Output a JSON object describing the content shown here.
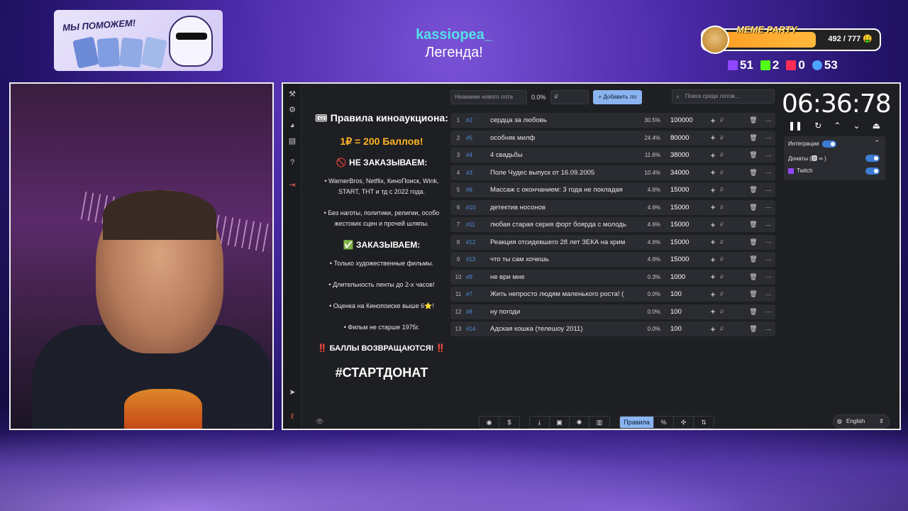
{
  "overlay": {
    "banner_text": "МЫ ПОМОЖЕМ!",
    "chat": {
      "username": "kassiopea_",
      "message": "Легенда!"
    },
    "meme_party": {
      "title": "MEME PARTY",
      "count": "492 / 777 🤑",
      "progress": 0.633
    },
    "stats": [
      {
        "icon": "twitch-icon",
        "value": "51",
        "color": "#9146ff"
      },
      {
        "icon": "kick-icon",
        "value": "2",
        "color": "#53fc18"
      },
      {
        "icon": "vklive-icon",
        "value": "0",
        "color": "#ff2d55"
      },
      {
        "icon": "viewer-icon",
        "value": "53",
        "color": "#4da3ff"
      }
    ]
  },
  "app": {
    "rules": {
      "title": "🎟 Правила киноаукциона:",
      "rate": "1₽ = 200 Баллов!",
      "no_heading": "🚫 НЕ ЗАКАЗЫВАЕМ:",
      "no_items": [
        "• WarnerBros, Netflix, КиноПоиск, Wink, START, ТНТ и тд с 2022 года.",
        "• Без наготы, политики, религии, особо жестоких сцен и прочей шляпы."
      ],
      "yes_heading": "✅ ЗАКАЗЫВАЕМ:",
      "yes_items": [
        "• Только художественные фильмы.",
        "• Длительность ленты до 2-х часов!",
        "• Оценка на Кинопоиске выше 6⭐!",
        "• Фильм не старше 1975г."
      ],
      "returns": "‼️ БАЛЛЫ ВОЗВРАЩАЮТСЯ! ‼️",
      "hashtag": "#СТАРТДОНАТ"
    },
    "toolbar": {
      "new_lot_placeholder": "Название нового лота",
      "percent": "0.0%",
      "amount_placeholder": "₽",
      "add_label": "+  Добавить ло",
      "search_placeholder": "Поиск среди лотов..."
    },
    "lots": [
      {
        "idx": "1",
        "id": "#2",
        "name": "сердца за любовь",
        "pct": "30.5%",
        "amount": "100000"
      },
      {
        "idx": "2",
        "id": "#5",
        "name": "особняк милф",
        "pct": "24.4%",
        "amount": "80000"
      },
      {
        "idx": "3",
        "id": "#4",
        "name": "4 свадьбы",
        "pct": "11.6%",
        "amount": "38000"
      },
      {
        "idx": "4",
        "id": "#3",
        "name": "Поле Чудес выпуск от 16.09.2005",
        "pct": "10.4%",
        "amount": "34000"
      },
      {
        "idx": "5",
        "id": "#6",
        "name": "Массаж с окончанием: 3 года не покладая",
        "pct": "4.6%",
        "amount": "15000"
      },
      {
        "idx": "6",
        "id": "#10",
        "name": "детектив носонов",
        "pct": "4.6%",
        "amount": "15000"
      },
      {
        "idx": "7",
        "id": "#11",
        "name": "любая старая серия форт боярда с молодь",
        "pct": "4.6%",
        "amount": "15000"
      },
      {
        "idx": "8",
        "id": "#12",
        "name": "Реакция отсидевшего 28 лет ЗЕКА на крим",
        "pct": "4.6%",
        "amount": "15000"
      },
      {
        "idx": "9",
        "id": "#13",
        "name": "что ты сам хочешь",
        "pct": "4.6%",
        "amount": "15000"
      },
      {
        "idx": "10",
        "id": "#9",
        "name": "не ври мне",
        "pct": "0.3%",
        "amount": "1000"
      },
      {
        "idx": "11",
        "id": "#7",
        "name": "Жить непросто людям маленького роста! (",
        "pct": "0.0%",
        "amount": "100"
      },
      {
        "idx": "12",
        "id": "#8",
        "name": "ну погоди",
        "pct": "0.0%",
        "amount": "100"
      },
      {
        "idx": "13",
        "id": "#14",
        "name": "Адская кошка (телешоу 2011)",
        "pct": "0.0%",
        "amount": "100"
      }
    ],
    "lot_symbols": {
      "plus": "+",
      "rub": "₽",
      "del": "🗑",
      "more": "···"
    },
    "timer": {
      "value": "06:36:78"
    },
    "integrations": {
      "label": "Интеграции",
      "donations_label": "Донаты (🅳 ∞ )",
      "twitch_label": "Twitch"
    },
    "bottom": {
      "rules_tab": "Правила",
      "percent_tab": "%",
      "language": "English"
    }
  }
}
